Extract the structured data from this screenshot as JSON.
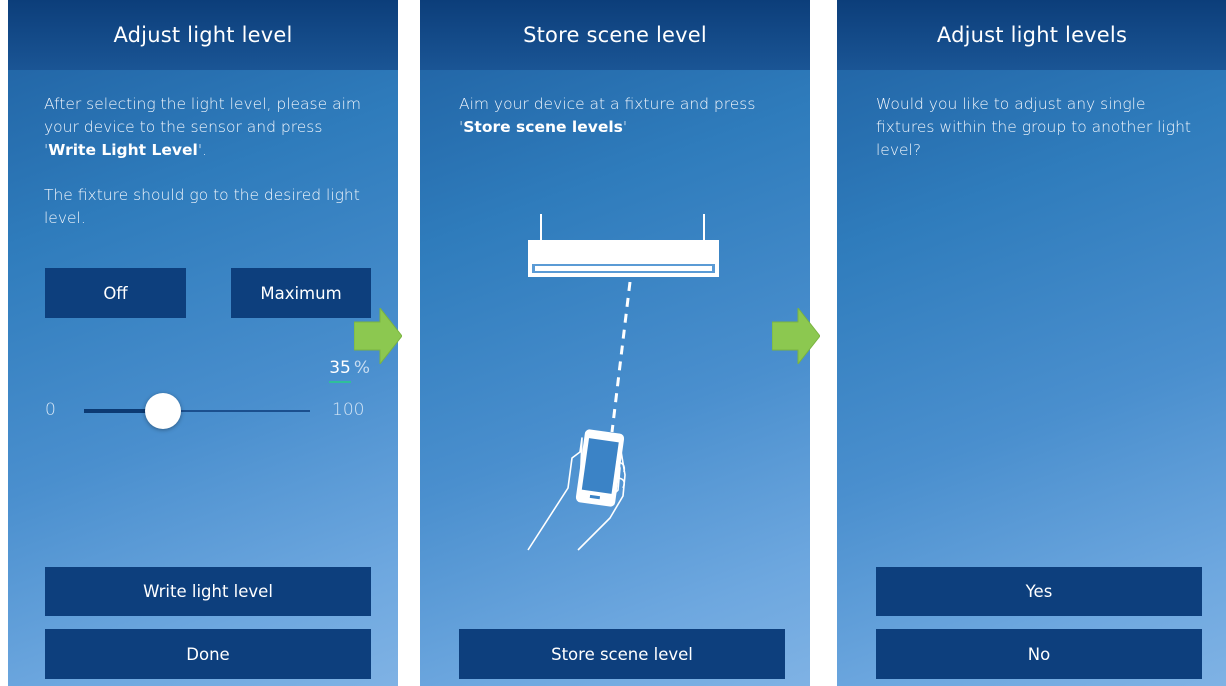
{
  "screen1": {
    "title": "Adjust light level",
    "para1_before": "After selecting the light level, please aim your device to the sensor and press '",
    "para1_bold": "Write Light Level",
    "para1_after": "'.",
    "para2": "The fixture should go to the desired light level.",
    "off_label": "Off",
    "maximum_label": "Maximum",
    "slider": {
      "value": 35,
      "unit": "%",
      "min_label": "0",
      "max_label": "100",
      "min": 0,
      "max": 100
    },
    "write_label": "Write light level",
    "done_label": "Done"
  },
  "screen2": {
    "title": "Store scene level",
    "para_before": "Aim your device at a fixture and press '",
    "para_bold": "Store scene levels",
    "para_after": "'",
    "store_label": "Store scene level"
  },
  "screen3": {
    "title": "Adjust light levels",
    "para": "Would you like to adjust any single fixtures within the group to another light level?",
    "yes_label": "Yes",
    "no_label": "No"
  },
  "colors": {
    "header": "#0c3e7a",
    "button": "#0d3f7d",
    "background_top": "#1e5fa0",
    "background_bottom": "#7fb2e4",
    "arrow": "#8cc850",
    "underline_accent": "#2fbf9a"
  },
  "icons": [
    "right-arrow-icon",
    "light-fixture-icon",
    "hand-phone-icon"
  ]
}
